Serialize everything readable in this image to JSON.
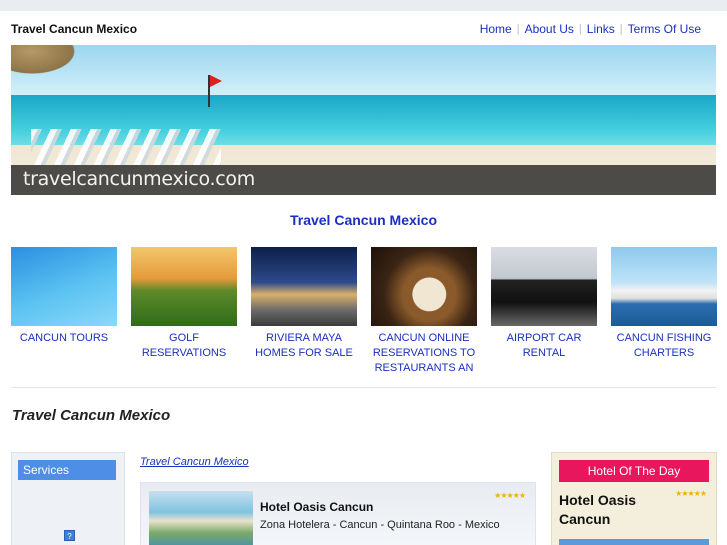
{
  "header": {
    "site_title": "Travel Cancun Mexico",
    "nav": [
      "Home",
      "About Us",
      "Links",
      "Terms Of Use"
    ]
  },
  "banner": {
    "caption": "travelcancunmexico.com"
  },
  "main": {
    "heading": "Travel Cancun Mexico",
    "tiles": [
      {
        "label": "CANCUN TOURS",
        "icon": "dolphin-swim-photo"
      },
      {
        "label": "GOLF RESERVATIONS",
        "icon": "golf-course-photo"
      },
      {
        "label": "RIVIERA MAYA HOMES FOR SALE",
        "icon": "house-night-photo"
      },
      {
        "label": "CANCUN ONLINE RESERVATIONS TO RESTAURANTS AN",
        "icon": "restaurant-dish-photo"
      },
      {
        "label": "AIRPORT CAR RENTAL",
        "icon": "minivan-photo"
      },
      {
        "label": "CANCUN FISHING CHARTERS",
        "icon": "fishing-boat-photo"
      }
    ],
    "section_heading": "Travel Cancun Mexico"
  },
  "sidebar_left": {
    "services_label": "Services",
    "icon_glyph": "?"
  },
  "content": {
    "breadcrumb": "Travel Cancun Mexico",
    "hotel": {
      "name": "Hotel Oasis Cancun",
      "address": "Zona Hotelera - Cancun - Quintana Roo - Mexico",
      "stars": "★★★★★",
      "rating": 5
    }
  },
  "sidebar_right": {
    "hotel_of_day_label": "Hotel Of The Day",
    "hotel_name": "Hotel Oasis Cancun",
    "stars": "★★★★★",
    "rating": 5
  },
  "colors": {
    "link": "#1a2fbf",
    "services_button": "#4f8ee6",
    "hotel_of_day_button": "#e8175d",
    "star": "#f0b400"
  }
}
